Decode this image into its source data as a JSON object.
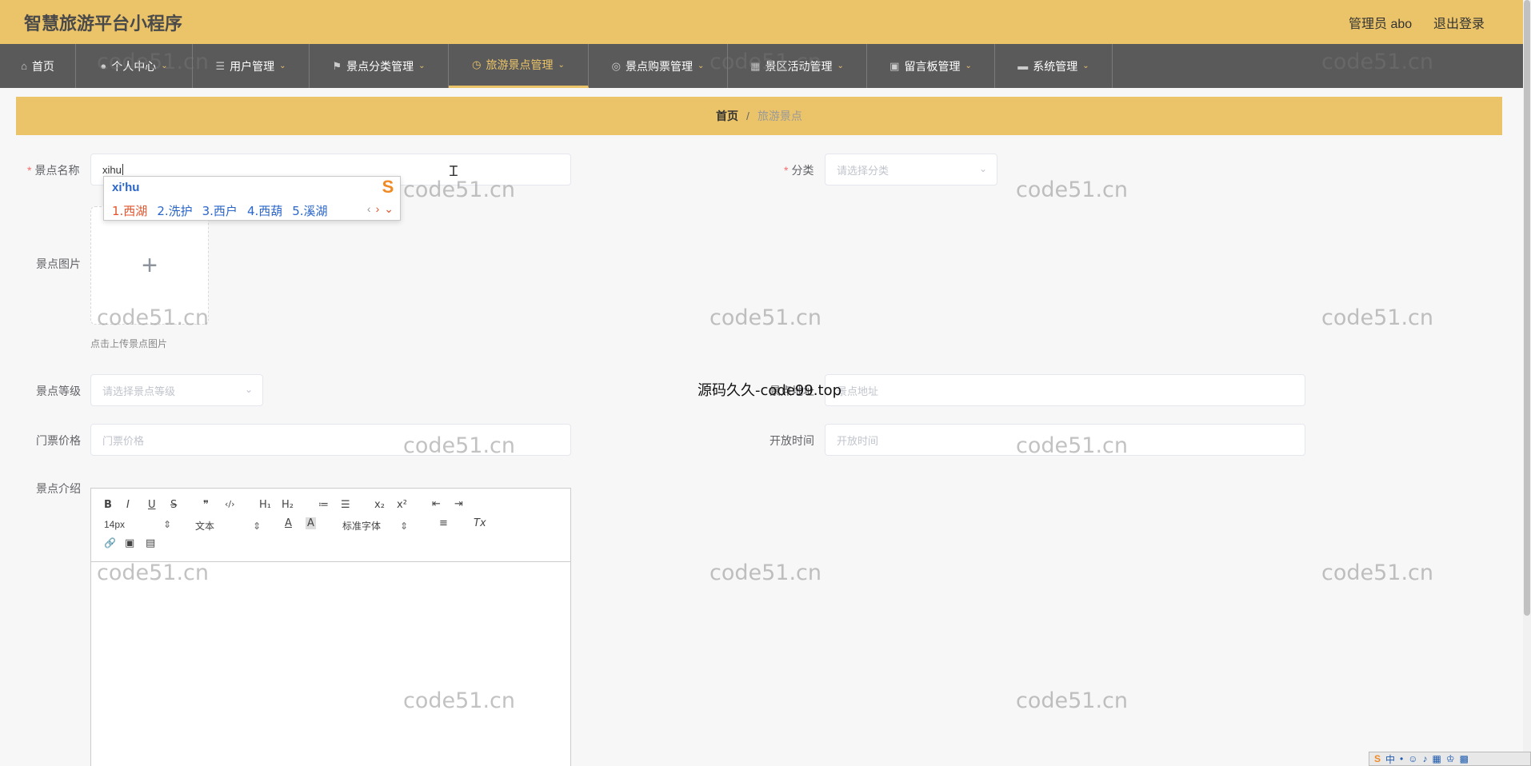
{
  "header": {
    "app_title": "智慧旅游平台小程序",
    "admin": "管理员 abo",
    "logout": "退出登录"
  },
  "nav": [
    {
      "label": "首页",
      "icon": "home-icon",
      "caret": false
    },
    {
      "label": "个人中心",
      "icon": "user-icon",
      "caret": true
    },
    {
      "label": "用户管理",
      "icon": "list-icon",
      "caret": true
    },
    {
      "label": "景点分类管理",
      "icon": "flag-icon",
      "caret": true
    },
    {
      "label": "旅游景点管理",
      "icon": "clock-icon",
      "caret": true,
      "active": true
    },
    {
      "label": "景点购票管理",
      "icon": "compass-icon",
      "caret": true
    },
    {
      "label": "景区活动管理",
      "icon": "calendar-icon",
      "caret": true
    },
    {
      "label": "留言板管理",
      "icon": "briefcase-icon",
      "caret": true
    },
    {
      "label": "系统管理",
      "icon": "monitor-icon",
      "caret": true
    }
  ],
  "breadcrumb": {
    "home": "首页",
    "separator": "/",
    "current": "旅游景点"
  },
  "form": {
    "name_label": "景点名称",
    "name_value": "xihu",
    "category_label": "分类",
    "category_placeholder": "请选择分类",
    "image_label": "景点图片",
    "upload_plus": "+",
    "upload_tip": "点击上传景点图片",
    "level_label": "景点等级",
    "level_placeholder": "请选择景点等级",
    "address_label": "景点地址",
    "address_placeholder": "景点地址",
    "price_label": "门票价格",
    "price_placeholder": "门票价格",
    "open_label": "开放时间",
    "open_placeholder": "开放时间",
    "intro_label": "景点介绍"
  },
  "ime": {
    "pinyin": "xi'hu",
    "logo": "S",
    "candidates": [
      "1.西湖",
      "2.洗护",
      "3.西户",
      "4.西葫",
      "5.溪湖"
    ],
    "prev": "‹",
    "next": "›",
    "expand": "⌄"
  },
  "editor_toolbar": {
    "bold": "B",
    "italic": "I",
    "underline": "U",
    "strike": "S",
    "quote": "❞",
    "code": "‹/›",
    "h1": "H₁",
    "h2": "H₂",
    "ordered": "≔",
    "bullet": "☰",
    "sub": "x₂",
    "sup": "x²",
    "outdent": "⇤",
    "indent": "⇥",
    "size": "14px",
    "header": "文本",
    "font": "标准字体",
    "color": "A",
    "background": "A",
    "align": "≡",
    "clean": "Tx",
    "link": "🔗",
    "image": "▣",
    "video": "▤"
  },
  "overlay_text": "源码久久-code99.top",
  "watermark": "code51.cn",
  "taskbar": {
    "ime_lang": "中"
  },
  "colors": {
    "accent": "#ebc469",
    "nav_bg": "#5a5a5a",
    "required": "#f56c6c"
  }
}
